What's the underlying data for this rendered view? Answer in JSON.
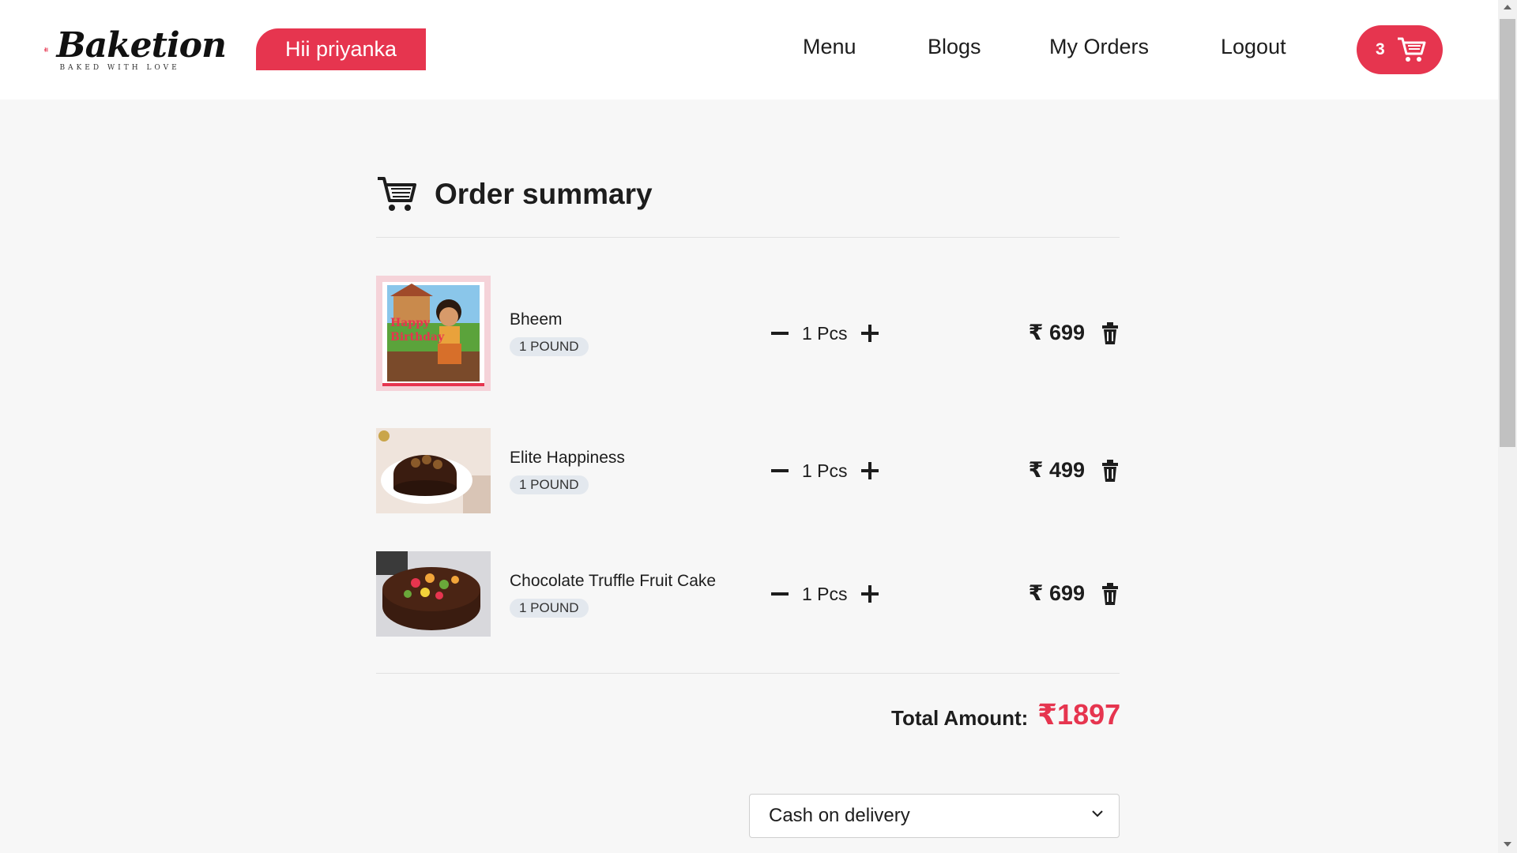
{
  "header": {
    "logo_word": "Baketion",
    "logo_tagline": "BAKED WITH LOVE",
    "greeting": "Hii priyanka",
    "nav": [
      {
        "label": "Menu"
      },
      {
        "label": "Blogs"
      },
      {
        "label": "My Orders"
      },
      {
        "label": "Logout"
      }
    ],
    "cart_count": "3"
  },
  "summary": {
    "title": "Order summary",
    "items": [
      {
        "name": "Bheem",
        "size": "1 POUND",
        "qty": "1 Pcs",
        "price": "₹ 699",
        "image": "birthday-cake-photo"
      },
      {
        "name": "Elite Happiness",
        "size": "1 POUND",
        "qty": "1 Pcs",
        "price": "₹ 499",
        "image": "chocolate-cake-photo"
      },
      {
        "name": "Chocolate Truffle Fruit Cake",
        "size": "1 POUND",
        "qty": "1 Pcs",
        "price": "₹ 699",
        "image": "fruit-cake-photo"
      }
    ],
    "total_label": "Total Amount:",
    "total_value": "₹1897"
  },
  "payment": {
    "selected": "Cash on delivery"
  },
  "colors": {
    "accent": "#e6354f",
    "background": "#f7f7f7"
  }
}
